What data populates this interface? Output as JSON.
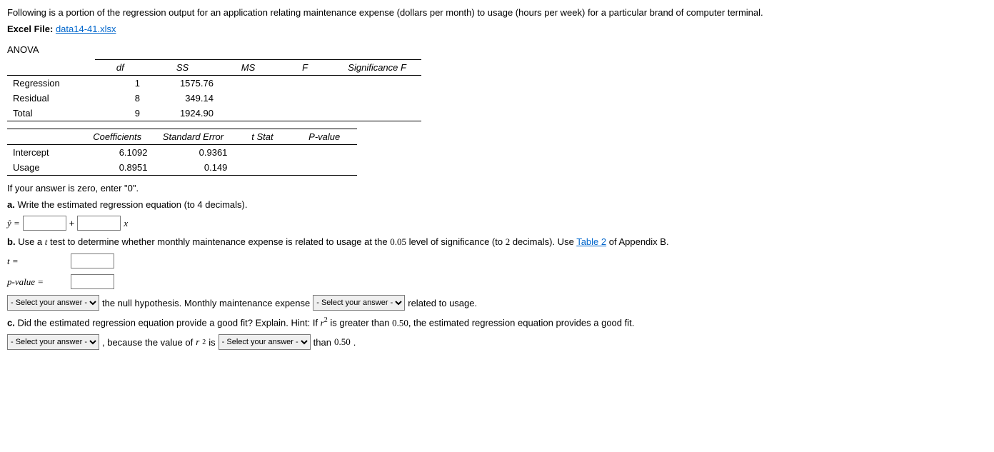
{
  "intro": "Following is a portion of the regression output for an application relating maintenance expense (dollars per month) to usage (hours per week) for a particular brand of computer terminal.",
  "excel_label": "Excel File:",
  "excel_link": "data14-41.xlsx",
  "anova_label": "ANOVA",
  "anova": {
    "headers": [
      "",
      "df",
      "SS",
      "MS",
      "F",
      "Significance F"
    ],
    "rows": [
      [
        "Regression",
        "1",
        "1575.76",
        "",
        "",
        ""
      ],
      [
        "Residual",
        "8",
        "349.14",
        "",
        "",
        ""
      ],
      [
        "Total",
        "9",
        "1924.90",
        "",
        "",
        ""
      ]
    ]
  },
  "coef": {
    "headers": [
      "",
      "Coefficients",
      "Standard Error",
      "t Stat",
      "P-value"
    ],
    "rows": [
      [
        "Intercept",
        "6.1092",
        "0.9361",
        "",
        ""
      ],
      [
        "Usage",
        "0.8951",
        "0.149",
        "",
        ""
      ]
    ]
  },
  "zero_note": "If your answer is zero, enter \"0\".",
  "a": {
    "label": "a.",
    "text": "Write the estimated regression equation (to 4 decimals).",
    "yhat": "ŷ =",
    "plus": "+",
    "x": "x"
  },
  "b": {
    "label": "b.",
    "text1": "Use a ",
    "t": "t",
    "text2": " test to determine whether monthly maintenance expense is related to usage at the ",
    "alpha": "0.05",
    "text3": " level of significance (to ",
    "dec": "2",
    "text4": " decimals). Use ",
    "table_link": "Table 2",
    "text5": " of Appendix B.",
    "t_label": "t =",
    "p_label": "p-value =",
    "select_placeholder": "- Select your answer -",
    "sent1": "the null hypothesis. Monthly maintenance expense",
    "sent2": "related to usage."
  },
  "c": {
    "label": "c.",
    "text1": "Did the estimated regression equation provide a good fit? Explain. Hint: If ",
    "r2": "r",
    "text2": " is greater than ",
    "thresh": "0.50",
    "text3": ", the estimated regression equation provides a good fit.",
    "sent1": ", because the value of ",
    "sent2": " is",
    "sent3": "than ",
    "thresh2": "0.50",
    "period": "."
  }
}
